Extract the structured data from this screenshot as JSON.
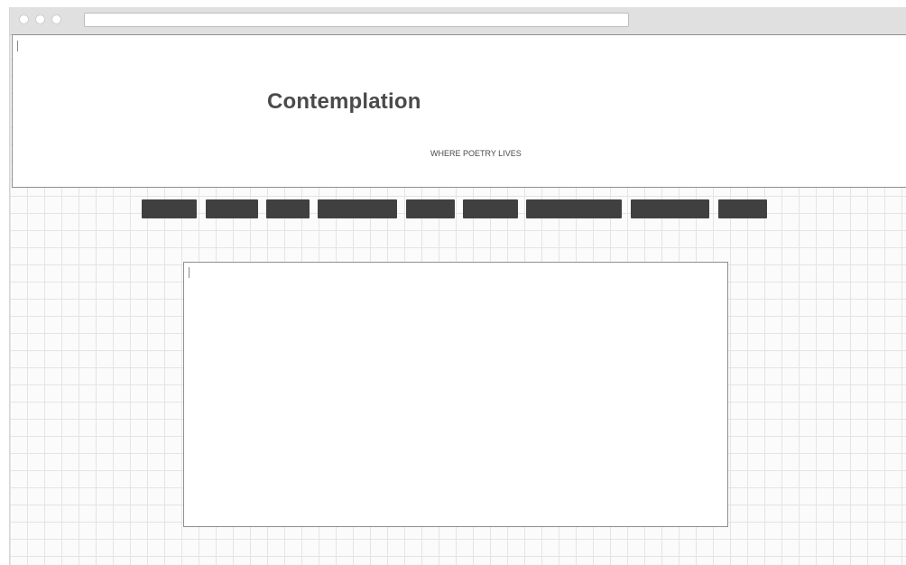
{
  "browser": {
    "address_value": ""
  },
  "header": {
    "title": "Contemplation",
    "tagline": "WHERE POETRY LIVES"
  },
  "nav": {
    "items": [
      {
        "label": ""
      },
      {
        "label": ""
      },
      {
        "label": ""
      },
      {
        "label": ""
      },
      {
        "label": ""
      },
      {
        "label": ""
      },
      {
        "label": ""
      },
      {
        "label": ""
      },
      {
        "label": ""
      }
    ]
  },
  "content": {
    "text": ""
  },
  "colors": {
    "nav_button": "#404040",
    "title_text": "#4a4a4a",
    "grid_line": "#e4e4e4",
    "border": "#8f8f8f"
  }
}
